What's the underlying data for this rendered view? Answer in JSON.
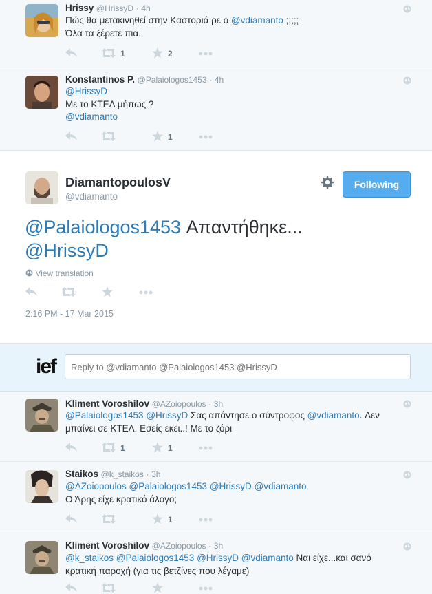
{
  "tweets_above": [
    {
      "name": "Hrissy",
      "handle": "@HrissyD",
      "time": "4h",
      "lines": [
        [
          {
            "t": "Πώς θα μετακινηθεί στην Καστοριά ρε ο ",
            "m": false
          },
          {
            "t": "@vdiamanto",
            "m": true
          },
          {
            "t": " ;;;;;",
            "m": false
          }
        ],
        [
          {
            "t": "Όλα τα ξέρετε πια.",
            "m": false
          }
        ]
      ],
      "retweets": "1",
      "favorites": "2"
    },
    {
      "name": "Konstantinos P.",
      "handle": "@Palaiologos1453",
      "time": "4h",
      "lines": [
        [
          {
            "t": "@HrissyD",
            "m": true
          }
        ],
        [
          {
            "t": "Με το ΚΤΕΛ μήπως ?",
            "m": false
          }
        ],
        [
          {
            "t": "@vdiamanto",
            "m": true
          }
        ]
      ],
      "retweets": "",
      "favorites": "1"
    }
  ],
  "main_tweet": {
    "name": "DiamantopoulosV",
    "handle": "@vdiamanto",
    "follow_label": "Following",
    "text_mention1": "@Palaiologos1453",
    "text_body": " Απαντήθηκε...",
    "text_mention2": "@HrissyD",
    "view_translation": "View translation",
    "timestamp": "2:16 PM - 17 Mar 2015"
  },
  "reply_box": {
    "placeholder": "Reply to @vdiamanto @Palaiologos1453 @HrissyD",
    "logo_text": "ief"
  },
  "tweets_below": [
    {
      "name": "Kliment Voroshilov",
      "handle": "@AZoiopoulos",
      "time": "3h",
      "lines": [
        [
          {
            "t": "@Palaiologos1453",
            "m": true
          },
          {
            "t": " ",
            "m": false
          },
          {
            "t": "@HrissyD",
            "m": true
          },
          {
            "t": " Σας απάντησε ο σύντροφος ",
            "m": false
          },
          {
            "t": "@vdiamanto",
            "m": true
          },
          {
            "t": ". Δεν",
            "m": false
          }
        ],
        [
          {
            "t": "μπαίνει σε ΚΤΕΛ. Εσείς εκει..! Με το ζόρι",
            "m": false
          }
        ]
      ],
      "retweets": "1",
      "favorites": "1"
    },
    {
      "name": "Staikos",
      "handle": "@k_staikos",
      "time": "3h",
      "lines": [
        [
          {
            "t": "@AZoiopoulos",
            "m": true
          },
          {
            "t": " ",
            "m": false
          },
          {
            "t": "@Palaiologos1453",
            "m": true
          },
          {
            "t": " ",
            "m": false
          },
          {
            "t": "@HrissyD",
            "m": true
          },
          {
            "t": " ",
            "m": false
          },
          {
            "t": "@vdiamanto",
            "m": true
          }
        ],
        [
          {
            "t": "Ο Άρης είχε κρατικό άλογο;",
            "m": false
          }
        ]
      ],
      "retweets": "",
      "favorites": "1"
    },
    {
      "name": "Kliment Voroshilov",
      "handle": "@AZoiopoulos",
      "time": "3h",
      "lines": [
        [
          {
            "t": "@k_staikos",
            "m": true
          },
          {
            "t": " ",
            "m": false
          },
          {
            "t": "@Palaiologos1453",
            "m": true
          },
          {
            "t": " ",
            "m": false
          },
          {
            "t": "@HrissyD",
            "m": true
          },
          {
            "t": " ",
            "m": false
          },
          {
            "t": "@vdiamanto",
            "m": true
          },
          {
            "t": " Ναι είχε...και σανό",
            "m": false
          }
        ],
        [
          {
            "t": "κρατική παροχή (για τις βετζίνες που λέγαμε)",
            "m": false
          }
        ]
      ],
      "retweets": "",
      "favorites": ""
    }
  ],
  "icons": {
    "reply": "reply-icon",
    "retweet": "retweet-icon",
    "favorite": "star-icon",
    "more": "more-icon",
    "globe": "globe-icon",
    "settings": "gear-icon"
  },
  "colors": {
    "link": "#2b7bb9",
    "follow_button": "#55acee",
    "background": "#f5f8fa"
  }
}
